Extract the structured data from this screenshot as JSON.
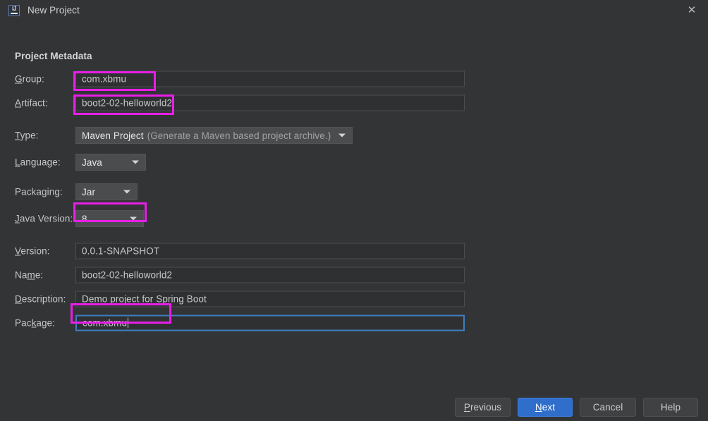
{
  "window": {
    "title": "New Project",
    "app_icon": "intellij-idea-icon",
    "close_label": "✕"
  },
  "section": {
    "title": "Project Metadata"
  },
  "fields": {
    "group": {
      "label": "Group:",
      "mnemonic": "G",
      "value": "com.xbmu"
    },
    "artifact": {
      "label": "Artifact:",
      "mnemonic": "A",
      "value": "boot2-02-helloworld2"
    },
    "type": {
      "label": "Type:",
      "mnemonic": "T",
      "value": "Maven Project",
      "hint": "(Generate a Maven based project archive.)"
    },
    "language": {
      "label": "Language:",
      "mnemonic": "L",
      "value": "Java"
    },
    "packaging": {
      "label": "Packaging:",
      "mnemonic": "g",
      "value": "Jar"
    },
    "java_version": {
      "label": "Java Version:",
      "mnemonic": "J",
      "value": "8"
    },
    "version": {
      "label": "Version:",
      "mnemonic": "V",
      "value": "0.0.1-SNAPSHOT"
    },
    "name": {
      "label": "Name:",
      "mnemonic": "m",
      "value": "boot2-02-helloworld2"
    },
    "description": {
      "label": "Description:",
      "mnemonic": "D",
      "value": "Demo project for Spring Boot"
    },
    "package": {
      "label": "Package:",
      "mnemonic": "k",
      "value": "com.xbmu"
    }
  },
  "buttons": {
    "previous": "Previous",
    "next": "Next",
    "cancel": "Cancel",
    "help": "Help"
  },
  "colors": {
    "dialog_background": "#333436",
    "annotation_highlight": "#e81ee8",
    "focus_border": "#3f7ebd",
    "default_button": "#2f6ecb",
    "combo_background": "#4a4c4e",
    "text_field_background": "#2f3032"
  },
  "annotations": {
    "highlighted_fields": [
      "group",
      "artifact",
      "java_version",
      "package"
    ],
    "focused_field": "package"
  }
}
